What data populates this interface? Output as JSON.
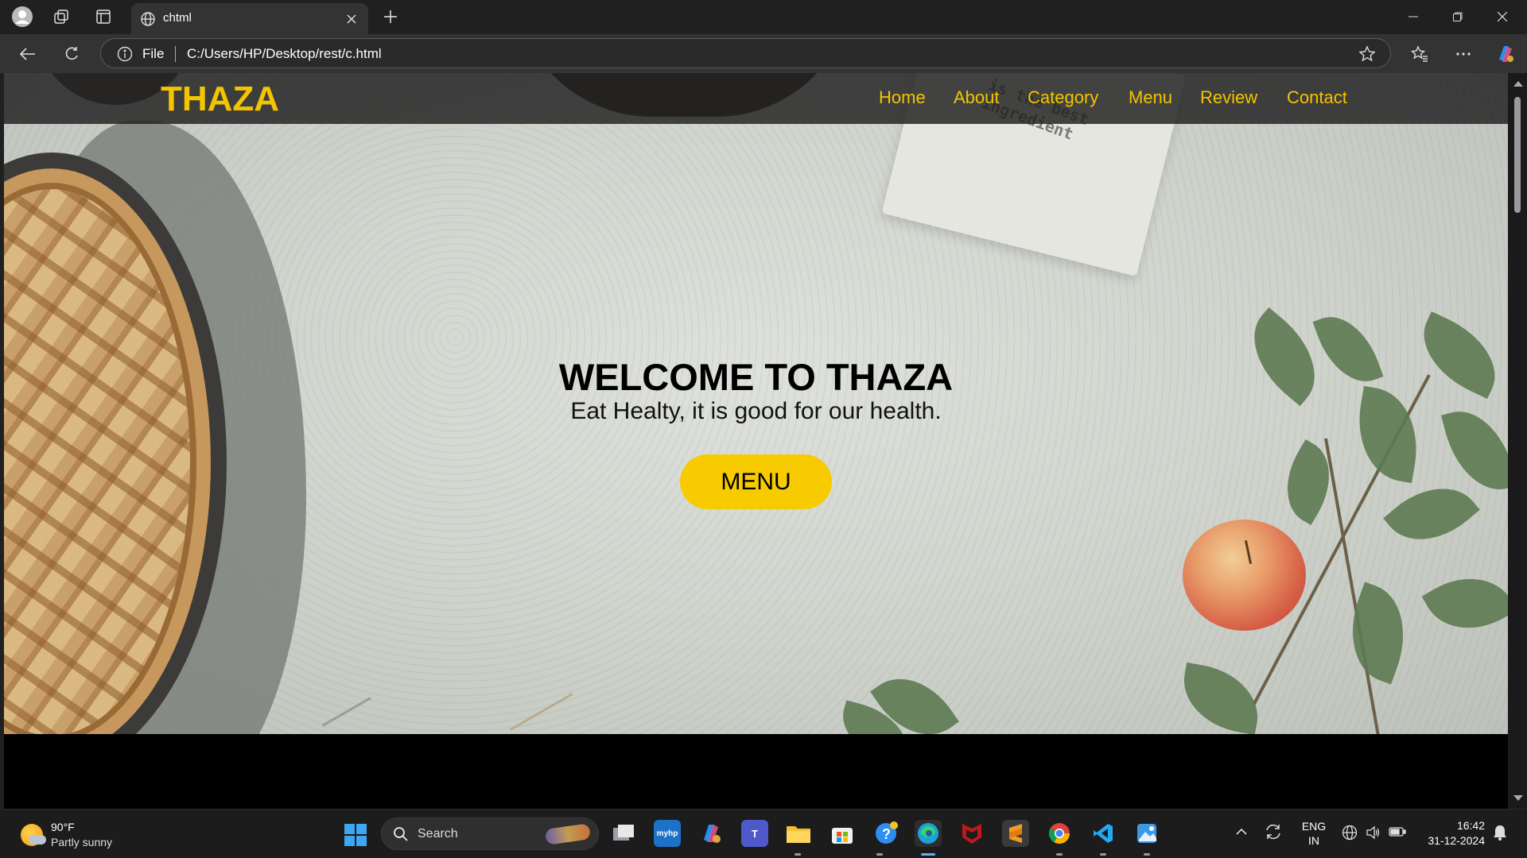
{
  "browser": {
    "tab_title": "chtml",
    "address_scheme": "File",
    "address_url": "C:/Users/HP/Desktop/rest/c.html"
  },
  "site": {
    "logo": "THAZA",
    "nav": [
      "Home",
      "About",
      "Category",
      "Menu",
      "Review",
      "Contact"
    ],
    "hero_title": "WELCOME TO THAZA",
    "hero_subtitle": "Eat Healty, it is good for our health.",
    "hero_button": "MENU",
    "napkin_text": "is the best ingredient",
    "accent_color": "#f4c400"
  },
  "taskbar": {
    "weather_temp": "90°F",
    "weather_condition": "Partly sunny",
    "search_label": "Search",
    "language": "ENG",
    "region": "IN",
    "time": "16:42",
    "date": "31-12-2024"
  }
}
